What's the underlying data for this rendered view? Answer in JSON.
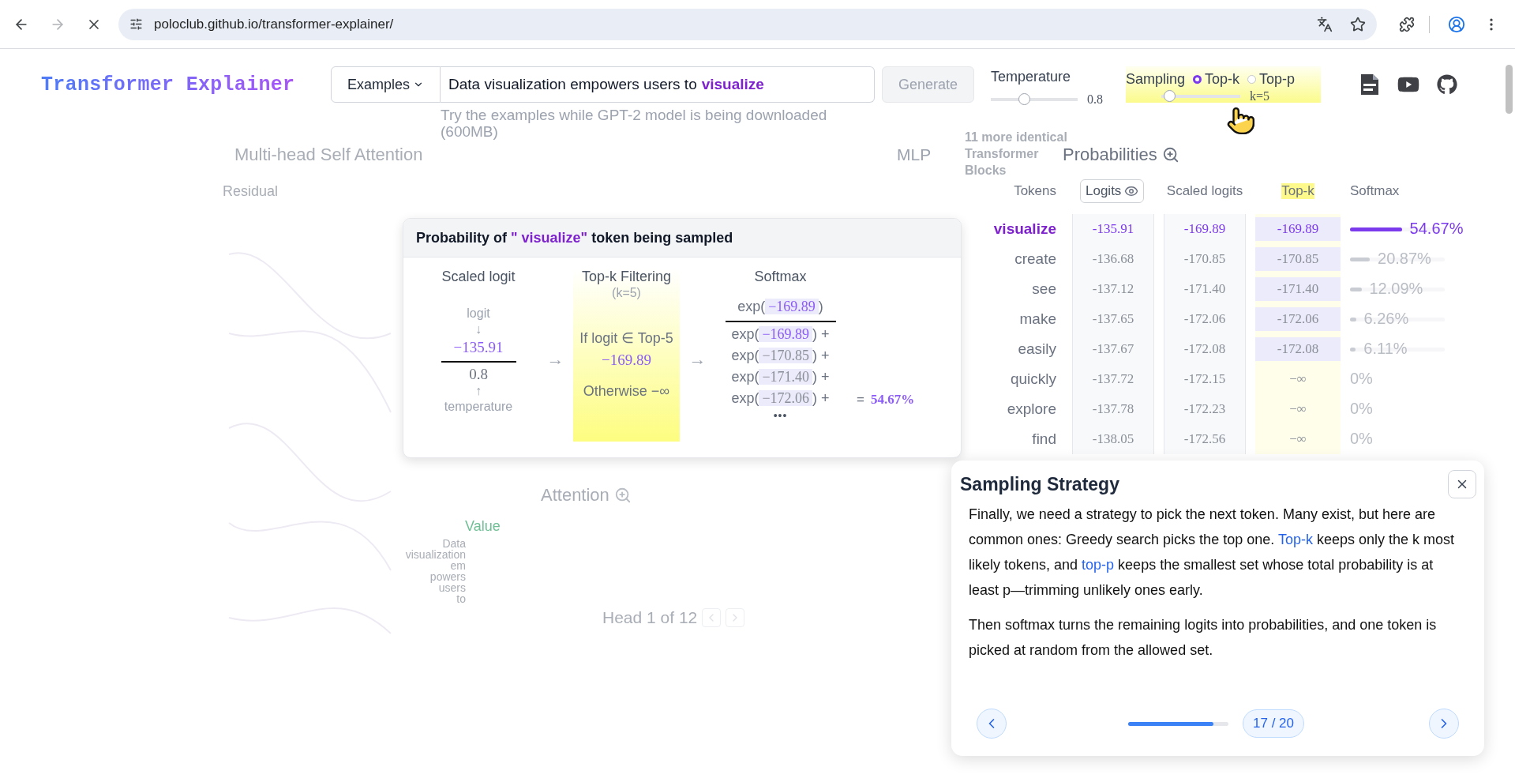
{
  "browser": {
    "url": "poloclub.github.io/transformer-explainer/",
    "forward_disabled": true
  },
  "header": {
    "logo": "Transformer Explainer",
    "examples_button": "Examples",
    "prompt_text": "Data visualization empowers users to",
    "prompt_prediction": "visualize",
    "generate_button": "Generate",
    "generate_disabled": true,
    "hint": "Try the examples while GPT-2 model is being downloaded (600MB)",
    "temperature": {
      "label": "Temperature",
      "level": 0.38,
      "reading": "0.8"
    },
    "sampling": {
      "label": "Sampling",
      "options": [
        {
          "label": "Top-k",
          "selected": true
        },
        {
          "label": "Top-p",
          "selected": false
        }
      ],
      "level": 0.1,
      "reading": "k=5"
    }
  },
  "diagram": {
    "title": "Multi-head Self Attention",
    "residual": "Residual",
    "mlp": "MLP",
    "blocks_note": [
      "11 more identical",
      "Transformer",
      "Blocks"
    ],
    "attention": "Attention",
    "value": "Value",
    "tokens": [
      "Data",
      "visualization",
      "em",
      "powers",
      "users",
      "to"
    ],
    "head": "Head 1 of 12"
  },
  "probabilities": {
    "title": "Probabilities",
    "headers": [
      {
        "label": "Tokens",
        "kind": "plain"
      },
      {
        "label": "Logits",
        "kind": "toggle"
      },
      {
        "label": "Scaled logits",
        "kind": "plain"
      },
      {
        "label": "Top-k",
        "kind": "highlight"
      },
      {
        "label": "Softmax",
        "kind": "plain"
      }
    ],
    "rows": [
      {
        "token": "visualize",
        "logit": "-135.91",
        "scaled": "-169.89",
        "topk": "-169.89",
        "in_topk": true,
        "softmax": "54.67%",
        "level": 0.5467,
        "selected": true
      },
      {
        "token": "create",
        "logit": "-136.68",
        "scaled": "-170.85",
        "topk": "-170.85",
        "in_topk": true,
        "softmax": "20.87%",
        "level": 0.2087,
        "selected": false
      },
      {
        "token": "see",
        "logit": "-137.12",
        "scaled": "-171.40",
        "topk": "-171.40",
        "in_topk": true,
        "softmax": "12.09%",
        "level": 0.1209,
        "selected": false
      },
      {
        "token": "make",
        "logit": "-137.65",
        "scaled": "-172.06",
        "topk": "-172.06",
        "in_topk": true,
        "softmax": "6.26%",
        "level": 0.0626,
        "selected": false
      },
      {
        "token": "easily",
        "logit": "-137.67",
        "scaled": "-172.08",
        "topk": "-172.08",
        "in_topk": true,
        "softmax": "6.11%",
        "level": 0.0611,
        "selected": false
      },
      {
        "token": "quickly",
        "logit": "-137.72",
        "scaled": "-172.15",
        "topk": "−∞",
        "in_topk": false,
        "softmax": "0%",
        "selected": false
      },
      {
        "token": "explore",
        "logit": "-137.78",
        "scaled": "-172.23",
        "topk": "−∞",
        "in_topk": false,
        "softmax": "0%",
        "selected": false
      },
      {
        "token": "find",
        "logit": "-138.05",
        "scaled": "-172.56",
        "topk": "−∞",
        "in_topk": false,
        "softmax": "0%",
        "selected": false
      }
    ]
  },
  "popup": {
    "title": {
      "prefix": "Probability of",
      "token": "\" visualize\"",
      "suffix": "token being sampled"
    },
    "scaled_logit": {
      "heading": "Scaled logit",
      "top_label": "logit",
      "down_arrow": "↓",
      "numerator": "−135.91",
      "denominator": "0.8",
      "up_arrow": "↑",
      "bottom_label": "temperature"
    },
    "arrows": [
      "→",
      "→"
    ],
    "filtering": {
      "heading": "Top-k Filtering",
      "note": "(k=5)",
      "condition": "If logit ∈ Top-5",
      "value": "−169.89",
      "otherwise": "Otherwise −∞"
    },
    "softmax": {
      "heading": "Softmax",
      "numerator": {
        "func": "exp(",
        "value": "−169.89",
        "close": ")"
      },
      "terms": [
        {
          "func": "exp(",
          "value": "−169.89",
          "close": ")",
          "plus": "+",
          "highlight": true
        },
        {
          "func": "exp(",
          "value": "−170.85",
          "close": ")",
          "plus": "+",
          "highlight": false
        },
        {
          "func": "exp(",
          "value": "−171.40",
          "close": ")",
          "plus": "+",
          "highlight": false
        },
        {
          "func": "exp(",
          "value": "−172.06",
          "close": ")",
          "plus": "+",
          "highlight": false
        }
      ],
      "ellipsis": "•••",
      "equals": "=",
      "result": "54.67%"
    }
  },
  "tour": {
    "title": "Sampling Strategy",
    "paragraphs": [
      [
        {
          "text": "Finally, we need a strategy to pick the next token. Many exist, but here are common ones: Greedy search picks the top one. ",
          "link": false
        },
        {
          "text": "Top-k",
          "link": true
        },
        {
          "text": " keeps only the k most likely tokens, and ",
          "link": false
        },
        {
          "text": "top-p",
          "link": true
        },
        {
          "text": " keeps the smallest set whose total probability is at least p—trimming unlikely ones early.",
          "link": false
        }
      ],
      [
        {
          "text": "Then softmax turns the remaining logits into probabilities, and one token is picked at random from the allowed set.",
          "link": false
        }
      ]
    ],
    "progress": {
      "level": 0.85,
      "label": "17 / 20"
    }
  }
}
